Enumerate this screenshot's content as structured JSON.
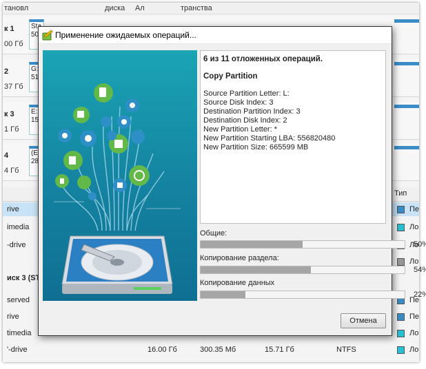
{
  "background": {
    "menu": [
      "тановл",
      "диска",
      "Ал",
      "транства"
    ],
    "disks": [
      {
        "label": "к 1",
        "size": "00 Гб",
        "part": "Sta\n50"
      },
      {
        "label": "2",
        "size": "37 Гб",
        "part": "G:\n51"
      },
      {
        "label": "к 3",
        "size": "1 Гб",
        "part": "E:F\n15"
      },
      {
        "label": "4",
        "size": "4 Гб",
        "part": "(E:\n28"
      }
    ],
    "table_header": "Тип",
    "rows": [
      {
        "name": "rive",
        "type": "Пе"
      },
      {
        "name": "imedia",
        "type": "Ло"
      },
      {
        "name": "-drive",
        "type": "Ло"
      },
      {
        "name": "",
        "type": "Ло"
      }
    ],
    "group": "иск 3 (ST",
    "rows2": [
      {
        "name": "served",
        "type": "Пе"
      },
      {
        "name": "rive",
        "type": "Пе"
      },
      {
        "name": "timedia",
        "type": "Ло"
      }
    ],
    "last_row": {
      "name": "'-drive",
      "c1": "16.00 Гб",
      "c2": "300.35 Мб",
      "c3": "15.71 Гб",
      "c4": "NTFS",
      "type": "Ло"
    }
  },
  "dialog": {
    "title": "Применение ожидаемых операций...",
    "status": "6 из 11 отложенных операций.",
    "operation": "Copy Partition",
    "details": [
      "Source Partition Letter: L:",
      "Source Disk Index: 3",
      "Destination Partition Index: 3",
      "Destination Disk Index: 2",
      "New Partition Letter: *",
      "New Partition Starting LBA: 556820480",
      "New Partition Size: 665599 MB"
    ],
    "progress": [
      {
        "label": "Общие:",
        "percent": 50,
        "percent_text": "50%"
      },
      {
        "label": "Копирование раздела:",
        "percent": 54,
        "percent_text": "54%"
      },
      {
        "label": "Копирование данных",
        "percent": 22,
        "percent_text": "22%"
      }
    ],
    "cancel_label": "Отмена"
  },
  "colors": {
    "accent": "#3a8dc7",
    "art_bg": "#1482a0",
    "icon_green": "#63b84a",
    "progress_fill": "#a6a6a6"
  },
  "icons": [
    "app-wizard-icon",
    "hard-drive-illustration"
  ]
}
